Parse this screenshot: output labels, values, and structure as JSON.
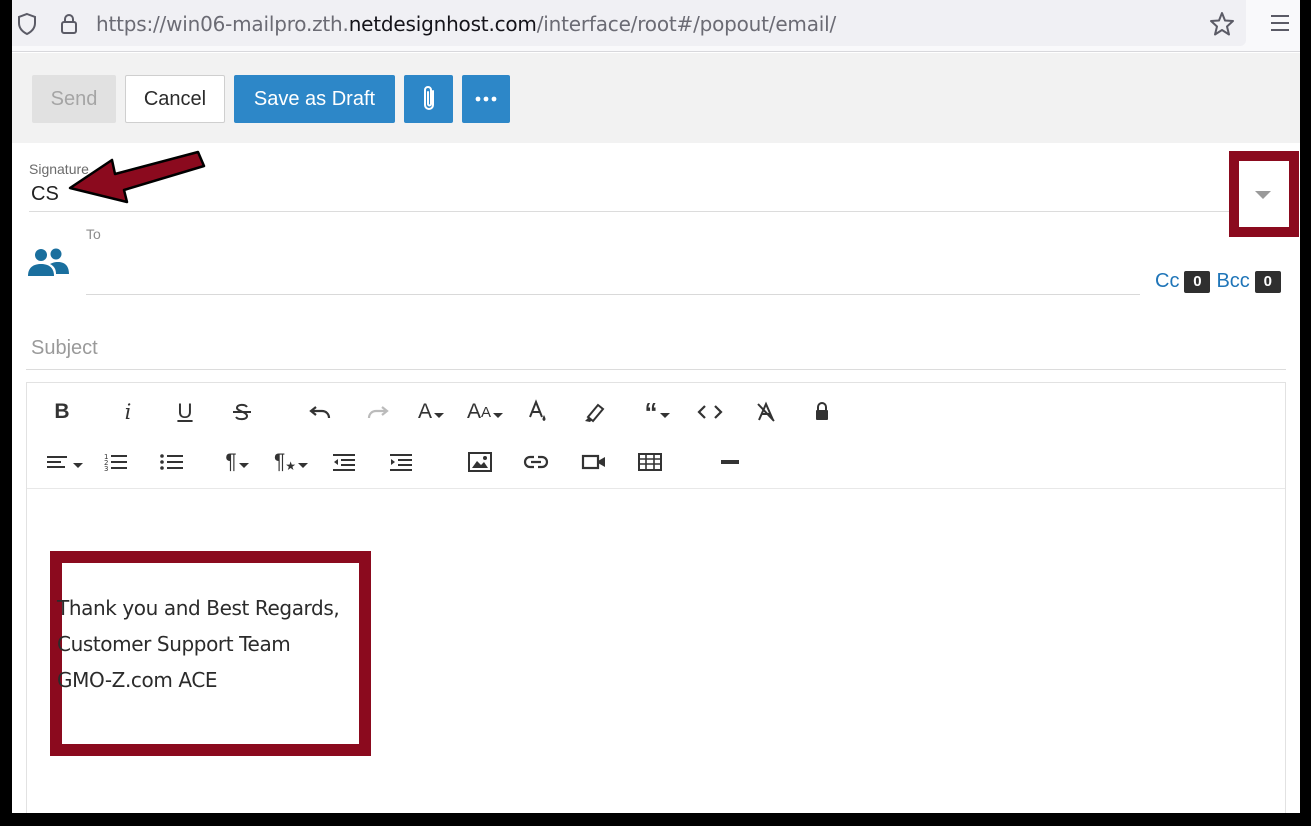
{
  "browser": {
    "url_prefix": "https://win06-mailpro.zth.",
    "url_domain": "netdesignhost.com",
    "url_path": "/interface/root#/popout/email/",
    "icons": [
      "shield-icon",
      "lock-icon",
      "star-icon",
      "hamburger-menu-icon"
    ]
  },
  "toolbar": {
    "send_label": "Send",
    "cancel_label": "Cancel",
    "save_draft_label": "Save as Draft",
    "attach_icon": "paperclip-icon",
    "more_icon": "ellipsis-icon"
  },
  "signature": {
    "label": "Signature",
    "value": "CS"
  },
  "recipients": {
    "to_label": "To",
    "to_value": "",
    "cc_label": "Cc",
    "cc_count": "0",
    "bcc_label": "Bcc",
    "bcc_count": "0"
  },
  "subject": {
    "placeholder": "Subject",
    "value": ""
  },
  "editor": {
    "toolbar_row1": [
      "bold",
      "italic",
      "underline",
      "strikethrough",
      "undo",
      "redo",
      "font-family",
      "font-size",
      "text-color",
      "background-color",
      "quote",
      "code-view",
      "clear-formatting",
      "lock"
    ],
    "toolbar_row2": [
      "align",
      "ordered-list",
      "unordered-list",
      "paragraph-format",
      "paragraph-style",
      "outdent",
      "indent",
      "insert-image",
      "insert-link",
      "insert-video",
      "insert-table",
      "horizontal-line"
    ],
    "body_lines": [
      "Thank you and Best Regards,",
      "Customer Support Team",
      "GMO-Z.com ACE"
    ]
  },
  "annotations": {
    "highlight_color": "#8b0a1e"
  },
  "colors": {
    "primary": "#2d87c8",
    "link": "#1f75b8",
    "people_icon": "#1a6f9e"
  }
}
